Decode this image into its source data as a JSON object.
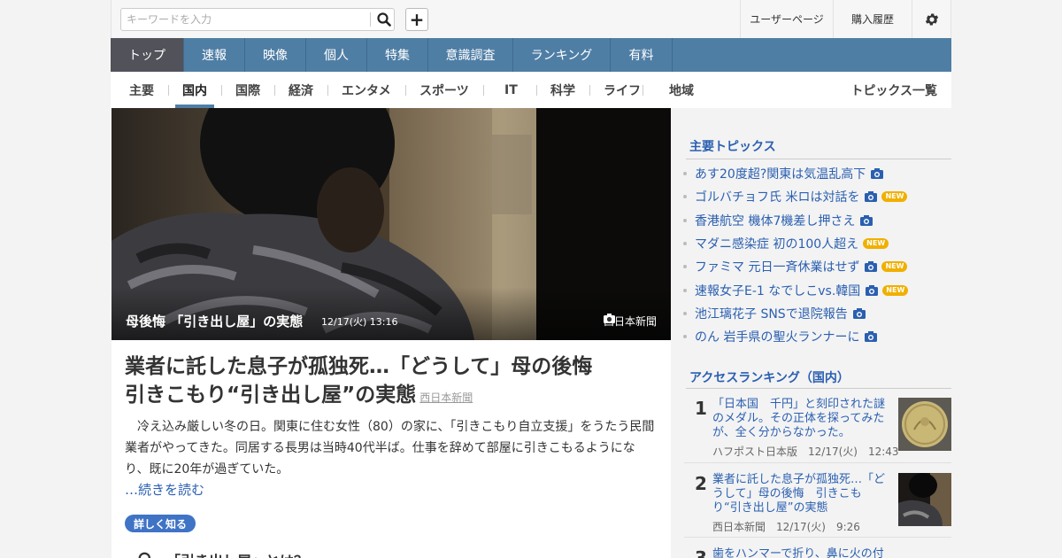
{
  "search": {
    "placeholder": "キーワードを入力"
  },
  "header_links": {
    "user_page": "ユーザーページ",
    "purchase_history": "購入履歴"
  },
  "nav": {
    "items": [
      "トップ",
      "速報",
      "映像",
      "個人",
      "特集",
      "意識調査",
      "ランキング",
      "有料"
    ],
    "active": "トップ"
  },
  "subnav": {
    "items": [
      "主要",
      "国内",
      "国際",
      "経済",
      "エンタメ",
      "スポーツ",
      "IT",
      "科学",
      "ライフ",
      "地域"
    ],
    "active": "国内",
    "topics_list": "トピックス一覧"
  },
  "hero": {
    "title": "母後悔 「引き出し屋」の実態",
    "time": "12/17(火) 13:16",
    "source": "西日本新聞"
  },
  "article": {
    "headline_line1": "業者に託した息子が孤独死…「どうして」母の後悔",
    "headline_line2": "引きこもり“引き出し屋”の実態",
    "source": "西日本新聞",
    "body": "冷え込み厳しい冬の日。関東に住む女性（80）の家に、「引きこもり自立支援」をうたう民間業者がやってきた。同居する長男は当時40代半ば。仕事を辞めて部屋に引きこもるようになり、既に20年が過ぎていた。",
    "read_more": "…続きを読む",
    "detail_button": "詳しく知る",
    "related": "「引き出し屋」とは？"
  },
  "sidebar": {
    "main_topics_heading": "主要トピックス",
    "topics": [
      {
        "label": "あす20度超?関東は気温乱高下",
        "camera": true,
        "new": false
      },
      {
        "label": "ゴルバチョフ氏 米ロは対話を",
        "camera": true,
        "new": true
      },
      {
        "label": "香港航空 機体7機差し押さえ",
        "camera": true,
        "new": false
      },
      {
        "label": "マダニ感染症 初の100人超え",
        "camera": false,
        "new": true
      },
      {
        "label": "ファミマ 元日一斉休業はせず",
        "camera": true,
        "new": true
      },
      {
        "label": "速報女子E-1 なでしこvs.韓国",
        "camera": true,
        "new": true
      },
      {
        "label": "池江璃花子 SNSで退院報告",
        "camera": true,
        "new": false
      },
      {
        "label": "のん 岩手県の聖火ランナーに",
        "camera": true,
        "new": false
      }
    ],
    "new_label": "NEW",
    "ranking_heading": "アクセスランキング（国内）",
    "ranking": [
      {
        "rank": "1",
        "title": "「日本国　千円」と刻印された謎のメダル。その正体を探ってみたが、全く分からなかった。",
        "source": "ハフポスト日本版",
        "time": "12/17(火)　12:43"
      },
      {
        "rank": "2",
        "title": "業者に託した息子が孤独死…「どうして」母の後悔　引きこもり“引き出し屋”の実態",
        "source": "西日本新聞",
        "time": "12/17(火)　9:26"
      },
      {
        "rank": "3",
        "title": "歯をハンマーで折り、鼻に火の付いたタバ",
        "source": "",
        "time": ""
      }
    ]
  }
}
